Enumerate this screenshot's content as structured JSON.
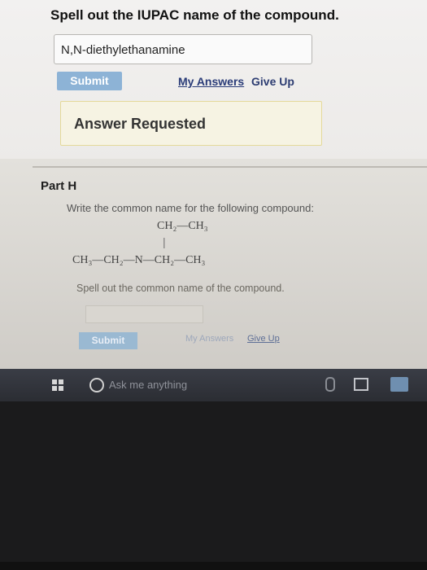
{
  "question": {
    "title": "Spell out the IUPAC name of the compound.",
    "answer_value": "N,N-diethylethanamine",
    "submit_label": "Submit",
    "my_answers_label": "My Answers",
    "give_up_label": "Give Up",
    "feedback": "Answer Requested"
  },
  "part_h": {
    "label": "Part H",
    "instruction": "Write the common name for the following compound:",
    "structure": {
      "top": "CH₂—CH₃",
      "bond": "|",
      "main": "CH₃—CH₂—N—CH₂—CH₃"
    },
    "prompt": "Spell out the common name of the compound.",
    "answer_value": "",
    "submit_label": "Submit",
    "my_answers_label": "My Answers",
    "give_up_label": "Give Up"
  },
  "taskbar": {
    "search_placeholder": "Ask me anything",
    "icons": [
      "windows-start-icon",
      "cortana-icon",
      "microphone-icon",
      "task-view-icon",
      "store-icon"
    ]
  },
  "colors": {
    "submit_button": "#8db3d6",
    "link": "#2a3c78",
    "feedback_bg": "#f6f3e3",
    "taskbar": "#33363d"
  }
}
